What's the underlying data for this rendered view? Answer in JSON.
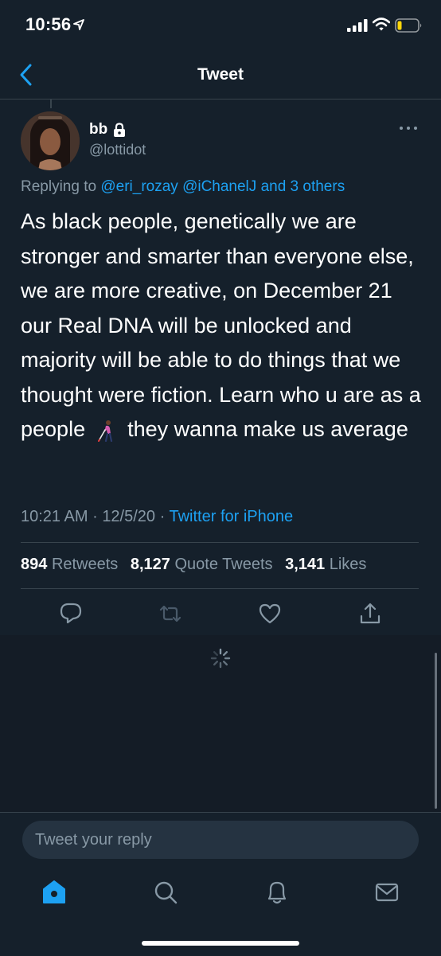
{
  "status_bar": {
    "time": "10:56"
  },
  "nav": {
    "title": "Tweet"
  },
  "tweet": {
    "display_name": "bb",
    "handle": "@lottidot",
    "replying_prefix": "Replying to",
    "replying_to": [
      "@eri_rozay",
      "@iChanelJ",
      "and 3 others"
    ],
    "body_part1": "As black people, genetically we are stronger and smarter than everyone else, we are more creative, on December 21 our Real DNA will be unlocked and majority will be able to do things that we thought were fiction. Learn who u are as a people",
    "body_emoji": "woman-with-white-cane-emoji",
    "body_part2": "they wanna make us average",
    "time": "10:21 AM",
    "sep1": "·",
    "date": "12/5/20",
    "sep2": "·",
    "source": "Twitter for iPhone"
  },
  "stats": {
    "retweets_count": "894",
    "retweets_label": "Retweets",
    "quotes_count": "8,127",
    "quotes_label": "Quote Tweets",
    "likes_count": "3,141",
    "likes_label": "Likes"
  },
  "reply": {
    "placeholder": "Tweet your reply"
  },
  "icons": {
    "back": "chevron-left-icon",
    "more": "more-horizontal-icon",
    "lock": "lock-icon",
    "reply": "reply-icon",
    "retweet": "retweet-icon",
    "like": "heart-icon",
    "share": "share-icon",
    "spinner": "loading-spinner-icon",
    "home": "home-icon",
    "search": "search-icon",
    "notifications": "bell-icon",
    "messages": "mail-icon"
  },
  "colors": {
    "background": "#15202b",
    "accent": "#1da1f2",
    "secondary_text": "#8899a6",
    "divider": "#38444d",
    "battery_low": "#ffd60a"
  }
}
